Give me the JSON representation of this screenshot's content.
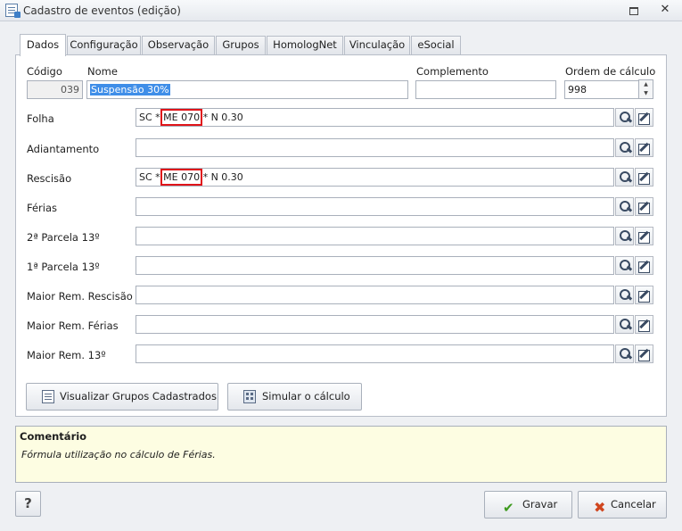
{
  "window": {
    "title": "Cadastro de eventos (edição)",
    "restore": "",
    "close": "✕"
  },
  "tabs": [
    {
      "label": "Dados"
    },
    {
      "label": "Configuração"
    },
    {
      "label": "Observação"
    },
    {
      "label": "Grupos"
    },
    {
      "label": "HomologNet"
    },
    {
      "label": "Vinculação"
    },
    {
      "label": "eSocial"
    }
  ],
  "header": {
    "codigo_label": "Código",
    "codigo_value": "039",
    "nome_label": "Nome",
    "nome_value": "Suspensão 30%",
    "complemento_label": "Complemento",
    "complemento_value": "",
    "ordem_label": "Ordem de cálculo",
    "ordem_value": "998"
  },
  "formulas": [
    {
      "label": "Folha",
      "prefix": "SC * ",
      "mid": "ME 070",
      "suffix": " * N 0.30"
    },
    {
      "label": "Adiantamento",
      "prefix": "",
      "mid": "",
      "suffix": ""
    },
    {
      "label": "Rescisão",
      "prefix": "SC * ",
      "mid": "ME 070",
      "suffix": " * N 0.30"
    },
    {
      "label": "Férias",
      "prefix": "",
      "mid": "",
      "suffix": ""
    },
    {
      "label": "2ª Parcela 13º",
      "prefix": "",
      "mid": "",
      "suffix": ""
    },
    {
      "label": "1ª Parcela 13º",
      "prefix": "",
      "mid": "",
      "suffix": ""
    },
    {
      "label": "Maior Rem. Rescisão",
      "prefix": "",
      "mid": "",
      "suffix": ""
    },
    {
      "label": "Maior Rem. Férias",
      "prefix": "",
      "mid": "",
      "suffix": ""
    },
    {
      "label": "Maior Rem. 13º",
      "prefix": "",
      "mid": "",
      "suffix": ""
    }
  ],
  "actions": {
    "view_groups": "Visualizar Grupos Cadastrados",
    "simulate": "Simular o cálculo"
  },
  "comment": {
    "title": "Comentário",
    "text": "Fórmula utilização no cálculo de Férias."
  },
  "footer": {
    "help": "?",
    "save": "Gravar",
    "cancel": "Cancelar"
  },
  "colors": {
    "highlight_box": "#e0141a",
    "comment_bg": "#fdfde2",
    "selection": "#3f8ee8"
  }
}
